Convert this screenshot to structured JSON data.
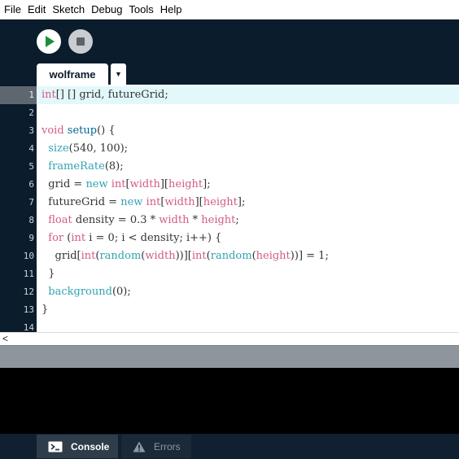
{
  "menu": {
    "items": [
      "File",
      "Edit",
      "Sketch",
      "Debug",
      "Tools",
      "Help"
    ]
  },
  "toolbar": {
    "run_icon": "play-icon",
    "stop_icon": "stop-icon"
  },
  "tabs": {
    "active_label": "wolframe",
    "menu_glyph": "▼"
  },
  "editor": {
    "line_numbers": [
      "1",
      "2",
      "3",
      "4",
      "5",
      "6",
      "7",
      "8",
      "9",
      "10",
      "11",
      "12",
      "13",
      "14"
    ],
    "active_line": 1
  },
  "scrollbar": {
    "left_arrow": "<"
  },
  "bottom_tabs": {
    "console_label": "Console",
    "errors_label": "Errors"
  },
  "colors": {
    "background": "#0b1c2c",
    "keyword": "#d45a88",
    "function": "#33a3b3",
    "active_line": "#e3f8fa",
    "run_green": "#1c8f3a"
  }
}
